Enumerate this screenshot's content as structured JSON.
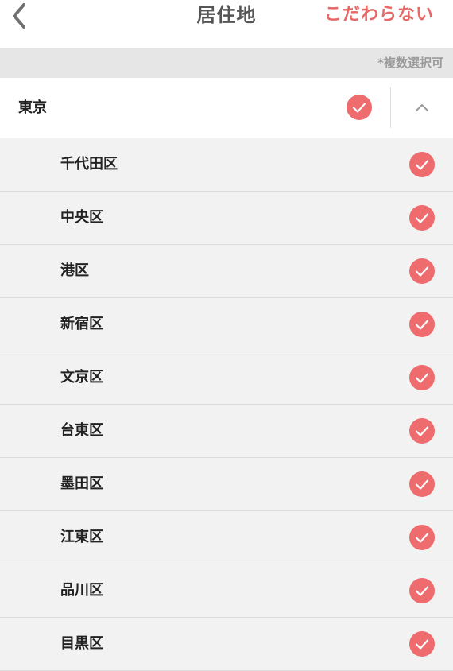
{
  "header": {
    "title": "居住地",
    "reset_label": "こだわらない"
  },
  "note": "*複数選択可",
  "prefecture": {
    "label": "東京",
    "checked": true
  },
  "wards": [
    {
      "label": "千代田区",
      "checked": true
    },
    {
      "label": "中央区",
      "checked": true
    },
    {
      "label": "港区",
      "checked": true
    },
    {
      "label": "新宿区",
      "checked": true
    },
    {
      "label": "文京区",
      "checked": true
    },
    {
      "label": "台東区",
      "checked": true
    },
    {
      "label": "墨田区",
      "checked": true
    },
    {
      "label": "江東区",
      "checked": true
    },
    {
      "label": "品川区",
      "checked": true
    },
    {
      "label": "目黒区",
      "checked": true
    }
  ],
  "colors": {
    "accent": "#ee6b6e",
    "header_bg": "#ffffff",
    "list_bg": "#f2f2f2"
  },
  "icons": {
    "back": "chevron-left-icon",
    "check": "check-circle-icon",
    "collapse": "chevron-up-icon"
  }
}
